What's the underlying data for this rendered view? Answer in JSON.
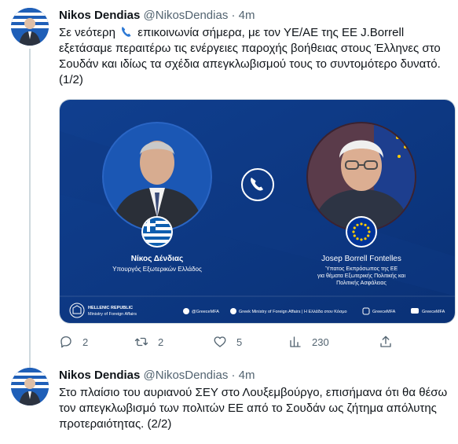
{
  "tweets": [
    {
      "author": {
        "name": "Nikos Dendias",
        "handle": "@NikosDendias",
        "time": "4m"
      },
      "text_before_icon": "Σε νεότερη ",
      "text_after_icon": " επικοινωνία σήμερα, με τον ΥΕ/ΑΕ της ΕΕ J.Borrell εξετάσαμε περαιτέρω τις ενέργειες παροχής βοήθειας στους Έλληνες στο Σουδάν και ιδίως τα σχέδια απεγκλωβισμού τους το συντομότερο δυνατό. (1/2)",
      "inline_icon": "telephone-receiver-emoji",
      "media": {
        "left_person_name": "Νίκος Δένδιας",
        "left_person_title": "Υπουργός Εξωτερικών Ελλάδος",
        "right_person_name": "Josep Borrell Fontelles",
        "right_person_title_line1": "Ύπατος Εκπρόσωπος της ΕΕ",
        "right_person_title_line2": "για θέματα Εξωτερικής Πολιτικής και",
        "right_person_title_line3": "Πολιτικής Ασφάλειας",
        "ministry_line1": "HELLENIC REPUBLIC",
        "ministry_line2": "Ministry of Foreign Affairs",
        "footer_social": [
          {
            "icon": "twitter-icon",
            "label": "@GreeceMFA"
          },
          {
            "icon": "facebook-icon",
            "label": "Greek Ministry of Foreign Affairs | Η Ελλάδα στον Κόσμο"
          },
          {
            "icon": "instagram-icon",
            "label": "GreeceMFA"
          },
          {
            "icon": "youtube-icon",
            "label": "GreeceMFA"
          }
        ],
        "center_icon": "phone-icon",
        "colors": {
          "background": "#0d3d8c",
          "accent": "#1d5bb5",
          "text": "#ffffff"
        }
      },
      "actions": {
        "replies": "2",
        "retweets": "2",
        "likes": "5",
        "views": "230"
      }
    },
    {
      "author": {
        "name": "Nikos Dendias",
        "handle": "@NikosDendias",
        "time": "4m"
      },
      "text": "Στο πλαίσιο του αυριανού ΣΕΥ στο Λουξεμβούργο, επισήμανα ότι θα θέσω τον απεγκλωβισμό των πολιτών ΕΕ από το Σουδάν ως ζήτημα απόλυτης προτεραιότητας. (2/2)"
    }
  ],
  "separator": " · "
}
